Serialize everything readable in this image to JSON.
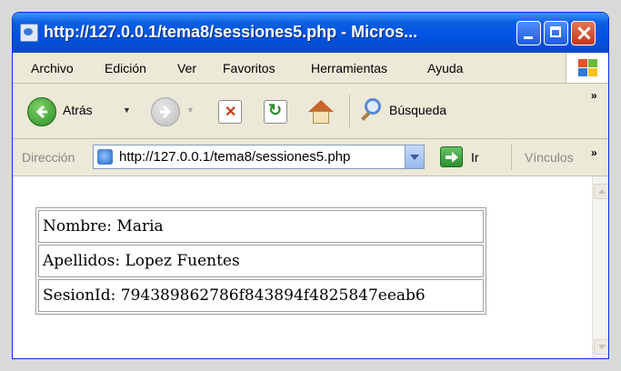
{
  "window": {
    "title": "http://127.0.0.1/tema8/sessiones5.php - Micros..."
  },
  "menu": [
    "Archivo",
    "Edición",
    "Ver",
    "Favoritos",
    "Herramientas",
    "Ayuda"
  ],
  "toolbar": {
    "back_label": "Atrás",
    "search_label": "Búsqueda",
    "chevron": "»"
  },
  "address": {
    "label": "Dirección",
    "url": "http://127.0.0.1/tema8/sessiones5.php",
    "go_label": "Ir",
    "links_label": "Vínculos",
    "chevron": "»"
  },
  "page": {
    "rows": [
      "Nombre: Maria",
      "Apellidos: Lopez Fuentes",
      "SesionId: 794389862786f843894f4825847eeab6"
    ]
  },
  "icons": {
    "back": "back-arrow-icon",
    "forward": "forward-arrow-icon",
    "stop": "stop-icon",
    "refresh": "refresh-icon",
    "home": "home-icon",
    "search": "search-icon",
    "go": "go-arrow-icon",
    "windows_logo": "windows-logo-icon"
  },
  "colors": {
    "titlebar": "#0054e3",
    "chrome": "#ece9d8",
    "close_button": "#c5341a",
    "content_bg": "#ffffff"
  }
}
